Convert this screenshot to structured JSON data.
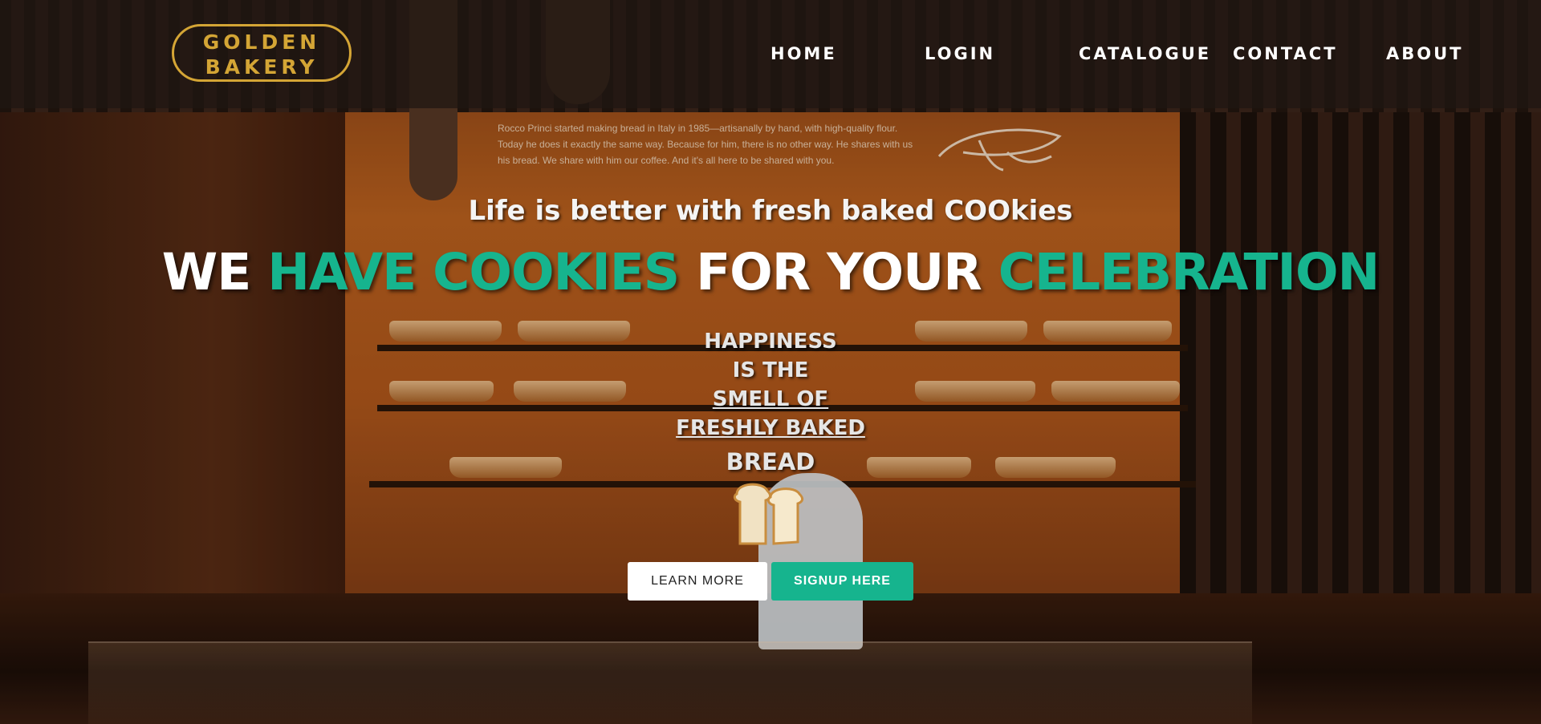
{
  "brand": {
    "line1": "GOLDEN",
    "line2": "BAKERY",
    "color": "#d4a535"
  },
  "nav": {
    "items": [
      "HOME",
      "LOGIN",
      "CATALOGUE",
      "CONTACT",
      "ABOUT"
    ]
  },
  "hero": {
    "tagline": "Life is better with fresh baked COOkies",
    "headline": {
      "part1": "WE ",
      "part2": "HAVE COOKIES",
      "part3": " FOR YOUR ",
      "part4": "CELEBRATION"
    },
    "stack": [
      "HAPPINESS",
      "IS THE",
      "SMELL OF",
      "FRESHLY BAKED",
      "BREAD"
    ],
    "bread_icon": "bread-slice-icon",
    "accent_color": "#16b48e"
  },
  "buttons": {
    "learn_more": "LEARN MORE",
    "signup": "SIGNUP HERE"
  },
  "background": {
    "sign_text": "Rocco Princi started making bread in Italy in 1985—artisanally by hand, with high-quality flour. Today he does it exactly the same way. Because for him, there is no other way. He shares with us his bread. We share with him our coffee. And it's all here to be shared with you.",
    "signature": "Princi"
  }
}
